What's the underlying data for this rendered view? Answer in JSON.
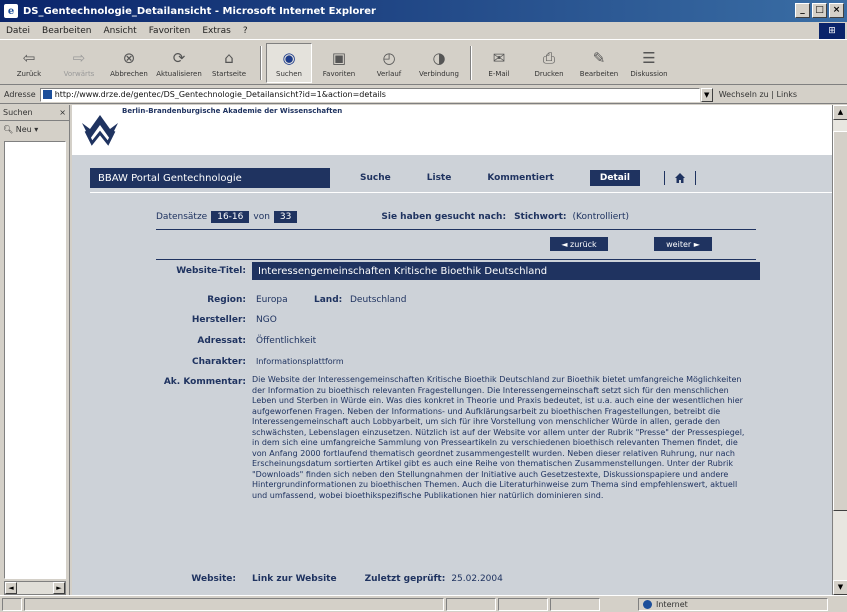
{
  "window": {
    "title": "DS_Gentechnologie_Detailansicht - Microsoft Internet Explorer",
    "controls": [
      "_",
      "□",
      "×"
    ]
  },
  "menu": [
    "Datei",
    "Bearbeiten",
    "Ansicht",
    "Favoriten",
    "Extras",
    "?"
  ],
  "toolbar": [
    {
      "label": "Zurück",
      "icon": "back-arrow-icon"
    },
    {
      "label": "Vorwärts",
      "icon": "forward-arrow-icon"
    },
    {
      "label": "Abbrechen",
      "icon": "stop-icon"
    },
    {
      "label": "Aktualisieren",
      "icon": "refresh-icon"
    },
    {
      "label": "Startseite",
      "icon": "home-icon"
    },
    {
      "label": "Suchen",
      "icon": "search-icon"
    },
    {
      "label": "Favoriten",
      "icon": "favorites-icon"
    },
    {
      "label": "Verlauf",
      "icon": "history-icon"
    },
    {
      "label": "Verbindung",
      "icon": "channels-icon"
    },
    {
      "label": "E-Mail",
      "icon": "mail-icon"
    },
    {
      "label": "Drucken",
      "icon": "print-icon"
    },
    {
      "label": "Bearbeiten",
      "icon": "edit-icon"
    },
    {
      "label": "Diskussion",
      "icon": "discuss-icon"
    }
  ],
  "address": {
    "label": "Adresse",
    "url": "http://www.drze.de/gentec/DS_Gentechnologie_Detailansicht?id=1&action=details",
    "go_label": "Wechseln zu",
    "links_label": "Links"
  },
  "explorer": {
    "header": "Suchen",
    "search": "Neu"
  },
  "page": {
    "institution": "Berlin-Brandenburgische Akademie der Wissenschaften",
    "portal_title": "BBAW Portal Gentechnologie",
    "nav": [
      "Suche",
      "Liste",
      "Kommentiert",
      "Detail"
    ],
    "results": {
      "label": "Datensätze",
      "range": "16-16",
      "of_label": "von",
      "total": "33",
      "searched_label": "Sie haben gesucht nach:",
      "keyword_label": "Stichwort:",
      "keyword_value": "(Kontrolliert)"
    },
    "pager": {
      "back": "◄ zurück",
      "next": "weiter ►"
    },
    "fields": {
      "title_label": "Website-Titel:",
      "title_value": "Interessengemeinschaften Kritische Bioethik Deutschland",
      "region_label": "Region:",
      "region_value": "Europa",
      "country_label": "Land:",
      "country_value": "Deutschland",
      "producer_label": "Hersteller:",
      "producer_value": "NGO",
      "audience_label": "Adressat:",
      "audience_value": "Öffentlichkeit",
      "character_label": "Charakter:",
      "character_value": "Informationsplattform",
      "comment_label": "Ak. Kommentar:",
      "comment_value": "Die Website der Interessengemeinschaften Kritische Bioethik Deutschland zur Bioethik bietet umfangreiche Möglichkeiten der Information zu bioethisch relevanten Fragestellungen. Die Interessengemeinschaft setzt sich für den menschlichen Leben und Sterben in Würde ein. Was dies konkret in Theorie und Praxis bedeutet, ist u.a. auch eine der wesentlichen hier aufgeworfenen Fragen. Neben der Informations- und Aufklärungsarbeit zu bioethischen Fragestellungen, betreibt die Interessengemeinschaft auch Lobbyarbeit, um sich für ihre Vorstellung von menschlicher Würde in allen, gerade den schwächsten, Lebenslagen einzusetzen. Nützlich ist auf der Website vor allem unter der Rubrik \"Presse\" der Pressespiegel, in dem sich eine umfangreiche Sammlung von Presseartikeln zu verschiedenen bioethisch relevanten Themen findet, die von Anfang 2000 fortlaufend thematisch geordnet zusammengestellt wurden. Neben dieser relativen Ruhrung, nur nach Erscheinungsdatum sortierten Artikel gibt es auch eine Reihe von thematischen Zusammenstellungen. Unter der Rubrik \"Downloads\" finden sich neben den Stellungnahmen der Initiative auch Gesetzestexte, Diskussionspapiere und andere Hintergrundinformationen zu bioethischen Themen. Auch die Literaturhinweise zum Thema sind empfehlenswert, aktuell und umfassend, wobei bioethikspezifische Publikationen hier natürlich dominieren sind."
    },
    "footer": {
      "website_label": "Website:",
      "website_link": "Link zur Website",
      "checked_label": "Zuletzt geprüft:",
      "checked_value": "25.02.2004"
    }
  },
  "status": {
    "zone": "Internet"
  },
  "colors": {
    "brand_navy": "#1f3360",
    "page_bg": "#cdd2d8",
    "chrome": "#d4d0c8"
  }
}
